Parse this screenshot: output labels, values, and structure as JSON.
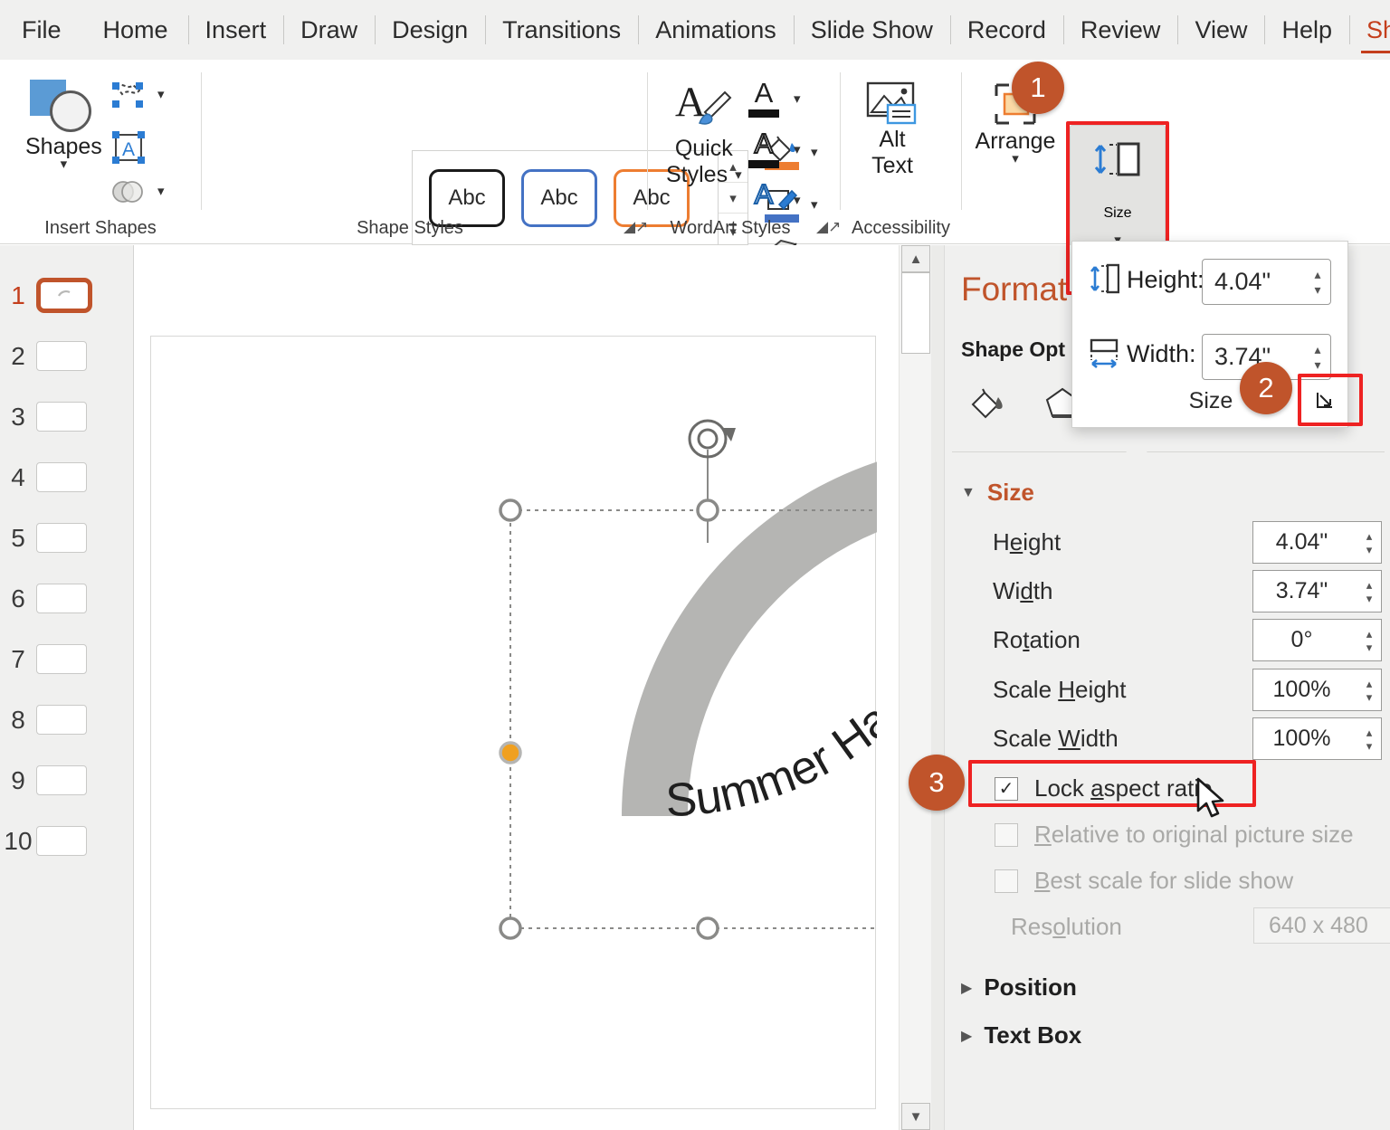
{
  "tabs": [
    {
      "label": "File",
      "active": false
    },
    {
      "label": "Home",
      "active": false
    },
    {
      "label": "Insert",
      "active": false
    },
    {
      "label": "Draw",
      "active": false
    },
    {
      "label": "Design",
      "active": false
    },
    {
      "label": "Transitions",
      "active": false
    },
    {
      "label": "Animations",
      "active": false
    },
    {
      "label": "Slide Show",
      "active": false
    },
    {
      "label": "Record",
      "active": false
    },
    {
      "label": "Review",
      "active": false
    },
    {
      "label": "View",
      "active": false
    },
    {
      "label": "Help",
      "active": false
    },
    {
      "label": "Shape Format",
      "active": true
    }
  ],
  "ribbon": {
    "groups": [
      {
        "label": "Insert Shapes"
      },
      {
        "label": "Shape Styles"
      },
      {
        "label": "WordArt Styles"
      },
      {
        "label": "Accessibility"
      }
    ],
    "shapes_button": "Shapes",
    "quick_styles": "Quick",
    "quick_styles2": "Styles",
    "alt_text": "Alt",
    "alt_text2": "Text",
    "arrange": "Arrange",
    "size": "Size",
    "gallery_items": [
      "Abc",
      "Abc",
      "Abc"
    ]
  },
  "badges": [
    {
      "n": "1"
    },
    {
      "n": "2"
    },
    {
      "n": "3"
    }
  ],
  "thumbnails": [
    {
      "n": "1",
      "selected": true
    },
    {
      "n": "2",
      "selected": false
    },
    {
      "n": "3",
      "selected": false
    },
    {
      "n": "4",
      "selected": false
    },
    {
      "n": "5",
      "selected": false
    },
    {
      "n": "6",
      "selected": false
    },
    {
      "n": "7",
      "selected": false
    },
    {
      "n": "8",
      "selected": false
    },
    {
      "n": "9",
      "selected": false
    },
    {
      "n": "10",
      "selected": false
    }
  ],
  "slide": {
    "wordart_text": "Summer Has Arrived"
  },
  "size_flyout": {
    "height_label": "Height:",
    "height_value": "4.04\"",
    "width_label": "Width:",
    "width_value": "3.74\"",
    "footer_label": "Size",
    "dialog_launcher": "⤵"
  },
  "pane": {
    "title": "Format",
    "subtitle": "Shape Opt",
    "size_section": "Size",
    "fields": [
      {
        "label_pre": "H",
        "label_acc": "e",
        "label_post": "ight",
        "value": "4.04\""
      },
      {
        "label_pre": "Wi",
        "label_acc": "d",
        "label_post": "th",
        "value": "3.74\""
      },
      {
        "label_pre": "Ro",
        "label_acc": "t",
        "label_post": "ation",
        "value": "0°"
      },
      {
        "label_pre": "Scale ",
        "label_acc": "H",
        "label_post": "eight",
        "value": "100%"
      },
      {
        "label_pre": "Scale ",
        "label_acc": "W",
        "label_post": "idth",
        "value": "100%"
      }
    ],
    "checkboxes": [
      {
        "pre": "Lock ",
        "acc": "a",
        "post": "spect ratio",
        "checked": true,
        "dim": false
      },
      {
        "pre": "",
        "acc": "R",
        "post": "elative to original picture size",
        "checked": false,
        "dim": true
      },
      {
        "pre": "",
        "acc": "B",
        "post": "est scale for slide show",
        "checked": false,
        "dim": true
      }
    ],
    "resolution_label_pre": "Res",
    "resolution_label_acc": "o",
    "resolution_label_post": "lution",
    "resolution_value": "640 x 480",
    "collapsed_sections": [
      "Position",
      "Text Box"
    ]
  },
  "colors": {
    "accent": "#c43e1c",
    "badge": "#c0542b",
    "highlight_box": "#ee2222",
    "ribbon_bg": "#f0f0ef",
    "pane_bg": "#f0f0ef"
  }
}
